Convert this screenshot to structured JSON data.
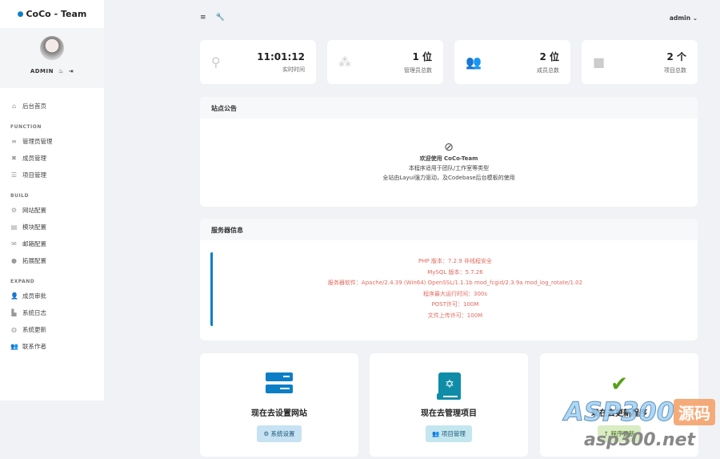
{
  "brand": "CoCo - Team",
  "user": {
    "name": "ADMIN",
    "top_name": "admin"
  },
  "nav": {
    "home": "后台首页",
    "sections": [
      {
        "title": "FUNCTION",
        "items": [
          "管理员管理",
          "成员管理",
          "项目管理"
        ]
      },
      {
        "title": "BUILD",
        "items": [
          "网站配置",
          "模块配置",
          "邮箱配置",
          "拓展配置"
        ]
      },
      {
        "title": "EXPAND",
        "items": [
          "成员审批",
          "系统日志",
          "系统更新",
          "联系作者"
        ]
      }
    ]
  },
  "stats": [
    {
      "value": "11:01:12",
      "label": "实时时间",
      "icon": "sitemap-icon"
    },
    {
      "value": "1 位",
      "label": "管理员总数",
      "icon": "admins-icon"
    },
    {
      "value": "2 位",
      "label": "成员总数",
      "icon": "users-icon"
    },
    {
      "value": "2 个",
      "label": "项目总数",
      "icon": "bag-icon"
    }
  ],
  "notice": {
    "title": "站点公告",
    "lines": [
      "欢迎使用 CoCo-Team",
      "本程序适用于团队/工作室等类型",
      "全站由Layui强力驱动，及Codebase后台模板的使用"
    ]
  },
  "server": {
    "title": "服务器信息",
    "lines": [
      "PHP 版本：7.2.9 非线程安全",
      "MySQL 版本：5.7.26",
      "服务器软件：Apache/2.4.39 (Win64) OpenSSL/1.1.1b mod_fcgid/2.3.9a mod_log_rotate/1.02",
      "程序最大运行时间：300s",
      "POST许可：100M",
      "文件上传许可：100M"
    ]
  },
  "actions": [
    {
      "title": "现在去设置网站",
      "button": "系统设置",
      "color": "#c6e2f3"
    },
    {
      "title": "现在去管理项目",
      "button": "项目管理",
      "color": "#c4e6ee"
    },
    {
      "title": "现在去更新程序",
      "button": "程序更新",
      "color": "#d9ecc3"
    }
  ],
  "watermark": {
    "a": "ASP300",
    "b": "源码",
    "c": "asp300.net"
  }
}
